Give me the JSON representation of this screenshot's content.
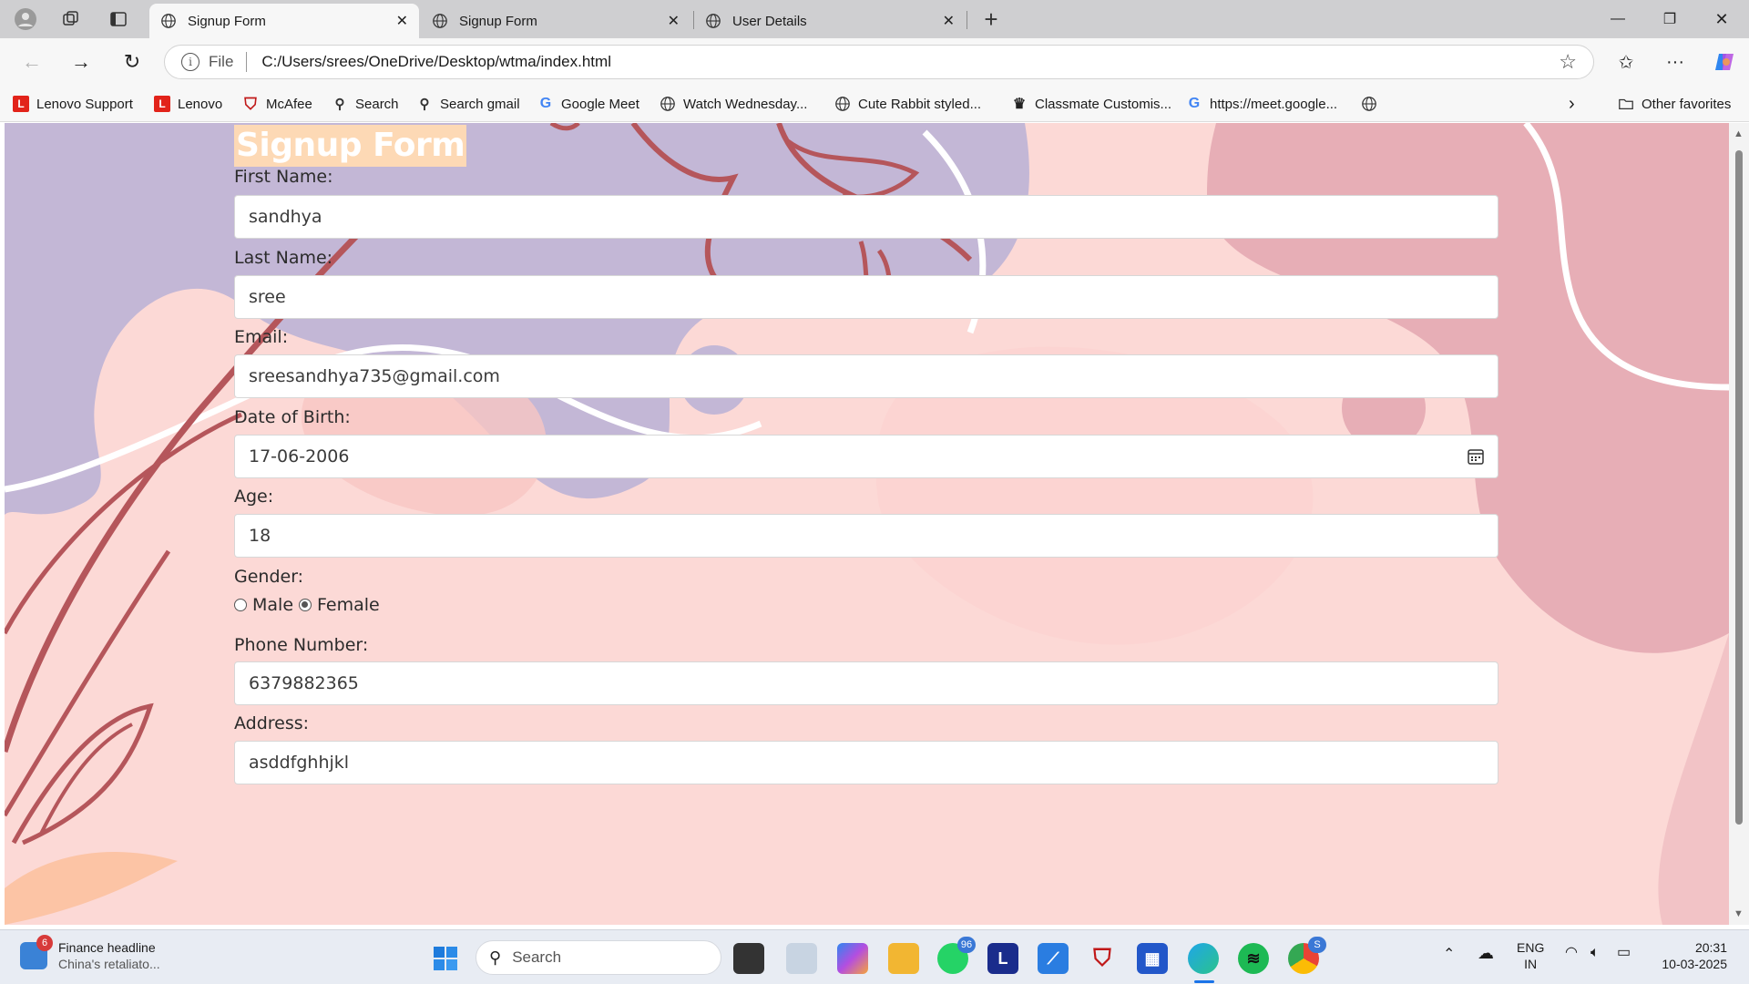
{
  "browser": {
    "tabs": [
      {
        "title": "Signup Form",
        "active": true
      },
      {
        "title": "Signup Form",
        "active": false
      },
      {
        "title": "User Details",
        "active": false
      }
    ],
    "address": {
      "scheme": "File",
      "url": "C:/Users/srees/OneDrive/Desktop/wtma/index.html"
    },
    "bookmarks": [
      {
        "label": "Lenovo Support",
        "icon": "lenovo-icon"
      },
      {
        "label": "Lenovo",
        "icon": "lenovo-icon"
      },
      {
        "label": "McAfee",
        "icon": "mcafee-icon"
      },
      {
        "label": "Search",
        "icon": "search-icon"
      },
      {
        "label": "Search gmail",
        "icon": "search-icon"
      },
      {
        "label": "Google Meet",
        "icon": "google-icon"
      },
      {
        "label": "Watch Wednesday...",
        "icon": "globe-icon"
      },
      {
        "label": "Cute Rabbit styled...",
        "icon": "globe-icon"
      },
      {
        "label": "Classmate Customis...",
        "icon": "classmate-icon"
      },
      {
        "label": "https://meet.google...",
        "icon": "google-icon"
      }
    ],
    "other_favorites": "Other favorites"
  },
  "form": {
    "title": "Signup Form",
    "first_name": {
      "label": "First Name:",
      "value": "sandhya"
    },
    "last_name": {
      "label": "Last Name:",
      "value": "sree"
    },
    "email": {
      "label": "Email:",
      "value": "sreesandhya735@gmail.com"
    },
    "dob": {
      "label": "Date of Birth:",
      "value": "17-06-2006"
    },
    "age": {
      "label": "Age:",
      "value": "18"
    },
    "gender": {
      "label": "Gender:",
      "options": [
        "Male",
        "Female"
      ],
      "selected": "Female"
    },
    "phone": {
      "label": "Phone Number:",
      "value": "6379882365"
    },
    "address": {
      "label": "Address:",
      "value": "asddfghhjkl"
    }
  },
  "taskbar": {
    "news_title": "Finance headline",
    "news_subtitle": "China's retaliato...",
    "news_badge": "6",
    "search_placeholder": "Search",
    "whatsapp_badge": "96",
    "chrome_badge": "S",
    "language": "ENG",
    "region": "IN",
    "time": "20:31",
    "date": "10-03-2025"
  },
  "colors": {
    "page_background": "#fcd9d6",
    "title_highlight": "#fdd9b5",
    "lavender_blob": "#c3b7d6",
    "rose_blob": "#e7aeb6",
    "leaf_stroke": "#b5565b"
  }
}
